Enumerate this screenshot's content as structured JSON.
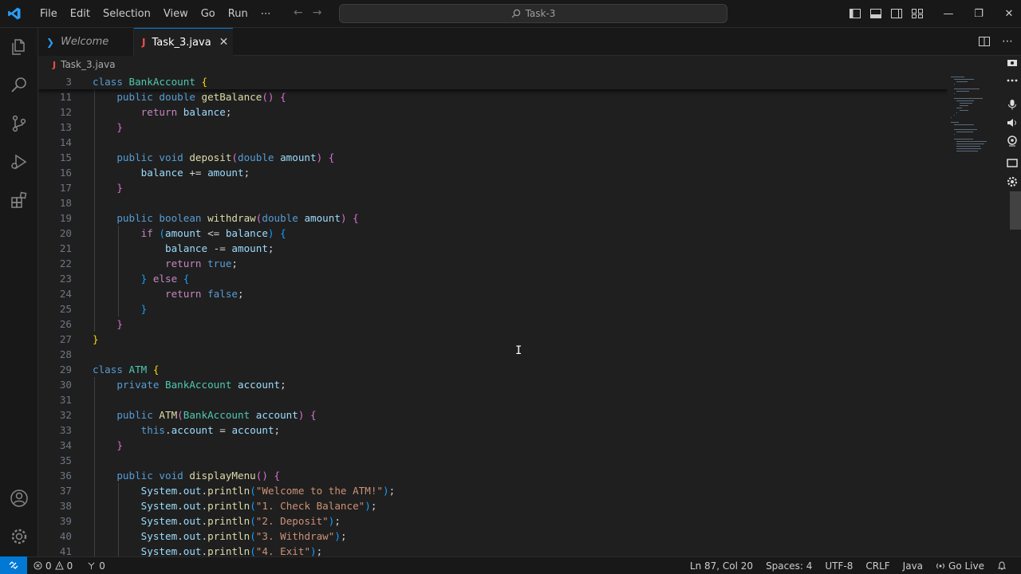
{
  "window": {
    "menu": [
      "File",
      "Edit",
      "Selection",
      "View",
      "Go",
      "Run",
      "⋯"
    ],
    "search_text": "Task-3"
  },
  "tabs": [
    {
      "label": "Welcome",
      "active": false
    },
    {
      "label": "Task_3.java",
      "active": true
    }
  ],
  "breadcrumb": "Task_3.java",
  "icons": {
    "activity": [
      "explorer-icon",
      "search-icon",
      "source-control-icon",
      "run-debug-icon",
      "extensions-icon"
    ],
    "activity_bottom": [
      "account-icon",
      "manage-gear-icon"
    ]
  },
  "editor": {
    "lines": [
      {
        "n": "3",
        "sticky": true,
        "tokens": [
          [
            "kw",
            "class "
          ],
          [
            "ty",
            "BankAccount "
          ],
          [
            "p1",
            "{"
          ]
        ]
      },
      {
        "n": "11",
        "tokens": [
          [
            "tx",
            "    "
          ],
          [
            "kw",
            "public "
          ],
          [
            "kw",
            "double "
          ],
          [
            "fn",
            "getBalance"
          ],
          [
            "p2",
            "()"
          ],
          [
            "tx",
            " "
          ],
          [
            "p2",
            "{"
          ]
        ]
      },
      {
        "n": "12",
        "tokens": [
          [
            "tx",
            "        "
          ],
          [
            "kw2",
            "return "
          ],
          [
            "va",
            "balance"
          ],
          [
            "tx",
            ";"
          ]
        ]
      },
      {
        "n": "13",
        "tokens": [
          [
            "tx",
            "    "
          ],
          [
            "p2",
            "}"
          ]
        ]
      },
      {
        "n": "14",
        "tokens": []
      },
      {
        "n": "15",
        "tokens": [
          [
            "tx",
            "    "
          ],
          [
            "kw",
            "public "
          ],
          [
            "kw",
            "void "
          ],
          [
            "fn",
            "deposit"
          ],
          [
            "p2",
            "("
          ],
          [
            "kw",
            "double "
          ],
          [
            "va",
            "amount"
          ],
          [
            "p2",
            ")"
          ],
          [
            "tx",
            " "
          ],
          [
            "p2",
            "{"
          ]
        ]
      },
      {
        "n": "16",
        "tokens": [
          [
            "tx",
            "        "
          ],
          [
            "va",
            "balance "
          ],
          [
            "tx",
            "+= "
          ],
          [
            "va",
            "amount"
          ],
          [
            "tx",
            ";"
          ]
        ]
      },
      {
        "n": "17",
        "tokens": [
          [
            "tx",
            "    "
          ],
          [
            "p2",
            "}"
          ]
        ]
      },
      {
        "n": "18",
        "tokens": []
      },
      {
        "n": "19",
        "tokens": [
          [
            "tx",
            "    "
          ],
          [
            "kw",
            "public "
          ],
          [
            "kw",
            "boolean "
          ],
          [
            "fn",
            "withdraw"
          ],
          [
            "p2",
            "("
          ],
          [
            "kw",
            "double "
          ],
          [
            "va",
            "amount"
          ],
          [
            "p2",
            ")"
          ],
          [
            "tx",
            " "
          ],
          [
            "p2",
            "{"
          ]
        ]
      },
      {
        "n": "20",
        "tokens": [
          [
            "tx",
            "        "
          ],
          [
            "kw2",
            "if "
          ],
          [
            "p3",
            "("
          ],
          [
            "va",
            "amount "
          ],
          [
            "tx",
            "<= "
          ],
          [
            "va",
            "balance"
          ],
          [
            "p3",
            ")"
          ],
          [
            "tx",
            " "
          ],
          [
            "p3",
            "{"
          ]
        ]
      },
      {
        "n": "21",
        "tokens": [
          [
            "tx",
            "            "
          ],
          [
            "va",
            "balance "
          ],
          [
            "tx",
            "-= "
          ],
          [
            "va",
            "amount"
          ],
          [
            "tx",
            ";"
          ]
        ]
      },
      {
        "n": "22",
        "tokens": [
          [
            "tx",
            "            "
          ],
          [
            "kw2",
            "return "
          ],
          [
            "kw",
            "true"
          ],
          [
            "tx",
            ";"
          ]
        ]
      },
      {
        "n": "23",
        "tokens": [
          [
            "tx",
            "        "
          ],
          [
            "p3",
            "}"
          ],
          [
            "tx",
            " "
          ],
          [
            "kw2",
            "else "
          ],
          [
            "p3",
            "{"
          ]
        ]
      },
      {
        "n": "24",
        "tokens": [
          [
            "tx",
            "            "
          ],
          [
            "kw2",
            "return "
          ],
          [
            "kw",
            "false"
          ],
          [
            "tx",
            ";"
          ]
        ]
      },
      {
        "n": "25",
        "tokens": [
          [
            "tx",
            "        "
          ],
          [
            "p3",
            "}"
          ]
        ]
      },
      {
        "n": "26",
        "tokens": [
          [
            "tx",
            "    "
          ],
          [
            "p2",
            "}"
          ]
        ]
      },
      {
        "n": "27",
        "tokens": [
          [
            "p1",
            "}"
          ]
        ]
      },
      {
        "n": "28",
        "tokens": []
      },
      {
        "n": "29",
        "tokens": [
          [
            "kw",
            "class "
          ],
          [
            "ty",
            "ATM "
          ],
          [
            "p1",
            "{"
          ]
        ]
      },
      {
        "n": "30",
        "tokens": [
          [
            "tx",
            "    "
          ],
          [
            "kw",
            "private "
          ],
          [
            "ty",
            "BankAccount "
          ],
          [
            "va",
            "account"
          ],
          [
            "tx",
            ";"
          ]
        ]
      },
      {
        "n": "31",
        "tokens": []
      },
      {
        "n": "32",
        "tokens": [
          [
            "tx",
            "    "
          ],
          [
            "kw",
            "public "
          ],
          [
            "fn",
            "ATM"
          ],
          [
            "p2",
            "("
          ],
          [
            "ty",
            "BankAccount "
          ],
          [
            "va",
            "account"
          ],
          [
            "p2",
            ")"
          ],
          [
            "tx",
            " "
          ],
          [
            "p2",
            "{"
          ]
        ]
      },
      {
        "n": "33",
        "tokens": [
          [
            "tx",
            "        "
          ],
          [
            "kw",
            "this"
          ],
          [
            "tx",
            "."
          ],
          [
            "va",
            "account "
          ],
          [
            "tx",
            "= "
          ],
          [
            "va",
            "account"
          ],
          [
            "tx",
            ";"
          ]
        ]
      },
      {
        "n": "34",
        "tokens": [
          [
            "tx",
            "    "
          ],
          [
            "p2",
            "}"
          ]
        ]
      },
      {
        "n": "35",
        "tokens": []
      },
      {
        "n": "36",
        "tokens": [
          [
            "tx",
            "    "
          ],
          [
            "kw",
            "public "
          ],
          [
            "kw",
            "void "
          ],
          [
            "fn",
            "displayMenu"
          ],
          [
            "p2",
            "()"
          ],
          [
            "tx",
            " "
          ],
          [
            "p2",
            "{"
          ]
        ]
      },
      {
        "n": "37",
        "tokens": [
          [
            "tx",
            "        "
          ],
          [
            "va",
            "System"
          ],
          [
            "tx",
            "."
          ],
          [
            "va",
            "out"
          ],
          [
            "tx",
            "."
          ],
          [
            "fn",
            "println"
          ],
          [
            "p3",
            "("
          ],
          [
            "st",
            "\"Welcome to the ATM!\""
          ],
          [
            "p3",
            ")"
          ],
          [
            "tx",
            ";"
          ]
        ]
      },
      {
        "n": "38",
        "tokens": [
          [
            "tx",
            "        "
          ],
          [
            "va",
            "System"
          ],
          [
            "tx",
            "."
          ],
          [
            "va",
            "out"
          ],
          [
            "tx",
            "."
          ],
          [
            "fn",
            "println"
          ],
          [
            "p3",
            "("
          ],
          [
            "st",
            "\"1. Check Balance\""
          ],
          [
            "p3",
            ")"
          ],
          [
            "tx",
            ";"
          ]
        ]
      },
      {
        "n": "39",
        "tokens": [
          [
            "tx",
            "        "
          ],
          [
            "va",
            "System"
          ],
          [
            "tx",
            "."
          ],
          [
            "va",
            "out"
          ],
          [
            "tx",
            "."
          ],
          [
            "fn",
            "println"
          ],
          [
            "p3",
            "("
          ],
          [
            "st",
            "\"2. Deposit\""
          ],
          [
            "p3",
            ")"
          ],
          [
            "tx",
            ";"
          ]
        ]
      },
      {
        "n": "40",
        "tokens": [
          [
            "tx",
            "        "
          ],
          [
            "va",
            "System"
          ],
          [
            "tx",
            "."
          ],
          [
            "va",
            "out"
          ],
          [
            "tx",
            "."
          ],
          [
            "fn",
            "println"
          ],
          [
            "p3",
            "("
          ],
          [
            "st",
            "\"3. Withdraw\""
          ],
          [
            "p3",
            ")"
          ],
          [
            "tx",
            ";"
          ]
        ]
      },
      {
        "n": "41",
        "tokens": [
          [
            "tx",
            "        "
          ],
          [
            "va",
            "System"
          ],
          [
            "tx",
            "."
          ],
          [
            "va",
            "out"
          ],
          [
            "tx",
            "."
          ],
          [
            "fn",
            "println"
          ],
          [
            "p3",
            "("
          ],
          [
            "st",
            "\"4. Exit\""
          ],
          [
            "p3",
            ")"
          ],
          [
            "tx",
            ";"
          ]
        ]
      }
    ]
  },
  "status": {
    "errors": "0",
    "warnings": "0",
    "ports": "0",
    "position": "Ln 87, Col 20",
    "spaces": "Spaces: 4",
    "encoding": "UTF-8",
    "eol": "CRLF",
    "language": "Java",
    "golive": "Go Live"
  },
  "colors": {
    "accent": "#0078d4",
    "java_icon": "#f14c4c"
  }
}
